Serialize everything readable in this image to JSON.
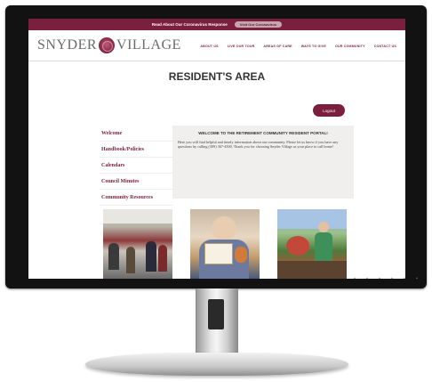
{
  "alert_bar": {
    "text": "Read About Our Coronavirus Response",
    "button": "Visit Our Coronavirus"
  },
  "header": {
    "logo_left": "SNYDER",
    "logo_right": "VILLAGE",
    "nav": [
      "ABOUT US",
      "LIVE OUR TOUR",
      "AREAS OF CARE",
      "WAYS TO GIVE",
      "OUR COMMUNITY",
      "CONTACT US"
    ]
  },
  "page": {
    "title": "RESIDENT'S AREA",
    "logout": "Logout"
  },
  "sidebar": {
    "items": [
      {
        "label": "Welcome"
      },
      {
        "label": "Handbook/Policies"
      },
      {
        "label": "Calendars"
      },
      {
        "label": "Council Minutes"
      },
      {
        "label": "Community Resources"
      }
    ]
  },
  "content": {
    "title": "WELCOME TO THE RETIREMENT COMMUNITY RESIDENT PORTAL!",
    "body": "Here you will find helpful and timely information about our community. Please let us know if you have any questions by calling (309) 367-4300. Thank you for choosing Snyder Village as your place to call home!"
  },
  "colors": {
    "brand": "#7a1f3d",
    "content_bg": "#f1eeee"
  }
}
